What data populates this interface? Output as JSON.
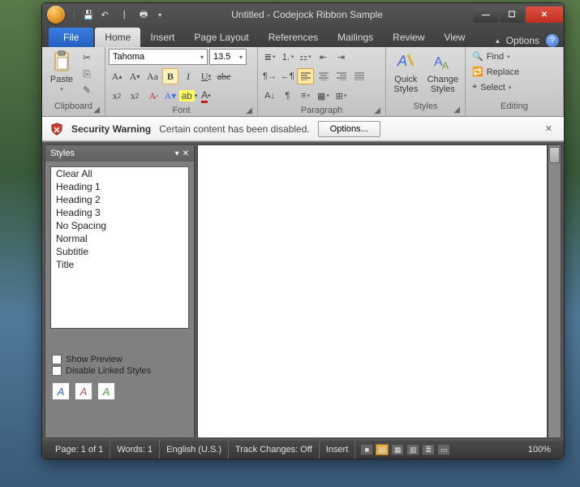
{
  "window": {
    "title": "Untitled - Codejock Ribbon Sample"
  },
  "tabs": {
    "file": "File",
    "items": [
      "Home",
      "Insert",
      "Page Layout",
      "References",
      "Mailings",
      "Review",
      "View"
    ],
    "active": "Home",
    "options": "Options"
  },
  "ribbon": {
    "clipboard": {
      "label": "Clipboard",
      "paste": "Paste"
    },
    "font": {
      "label": "Font",
      "name": "Tahoma",
      "size": "13.5"
    },
    "paragraph": {
      "label": "Paragraph"
    },
    "styles": {
      "label": "Styles",
      "quick": "Quick Styles",
      "change": "Change Styles"
    },
    "editing": {
      "label": "Editing",
      "find": "Find",
      "replace": "Replace",
      "select": "Select"
    }
  },
  "infobar": {
    "warning": "Security Warning",
    "message": "Certain content has been disabled.",
    "options": "Options..."
  },
  "pane": {
    "title": "Styles",
    "items": [
      "Clear All",
      "Heading 1",
      "Heading 2",
      "Heading 3",
      "No Spacing",
      "Normal",
      "Subtitle",
      "Title"
    ],
    "show_preview": "Show Preview",
    "disable_linked": "Disable Linked Styles"
  },
  "status": {
    "page": "Page: 1 of 1",
    "words": "Words: 1",
    "lang": "English (U.S.)",
    "track": "Track Changes: Off",
    "insert": "Insert",
    "zoom": "100%"
  }
}
